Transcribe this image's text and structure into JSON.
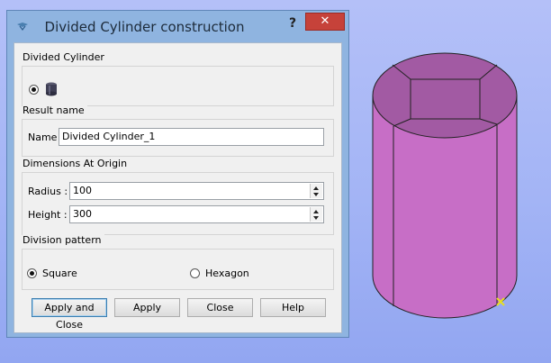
{
  "dialog": {
    "title": "Divided Cylinder construction",
    "help_label": "?",
    "close_label": "✕",
    "divided_cylinder": {
      "group_title": "Divided Cylinder"
    },
    "result": {
      "group_title": "Result name",
      "name_label": "Name",
      "name_value": "Divided Cylinder_1"
    },
    "dimensions": {
      "group_title": "Dimensions At Origin",
      "radius_label": "Radius :",
      "radius_value": "100",
      "height_label": "Height :",
      "height_value": "300"
    },
    "division": {
      "group_title": "Division pattern",
      "options": [
        {
          "label": "Square",
          "selected": true
        },
        {
          "label": "Hexagon",
          "selected": false
        }
      ]
    },
    "buttons": {
      "apply_close": "Apply and Close",
      "apply": "Apply",
      "close": "Close",
      "help": "Help"
    }
  },
  "colors": {
    "viewport_bg": "#a3b4f5",
    "cylinder_side": "#c76ec6",
    "cylinder_top": "#a25aa3",
    "dialog_frame": "#8fb4e0",
    "close_button": "#c6423a"
  }
}
